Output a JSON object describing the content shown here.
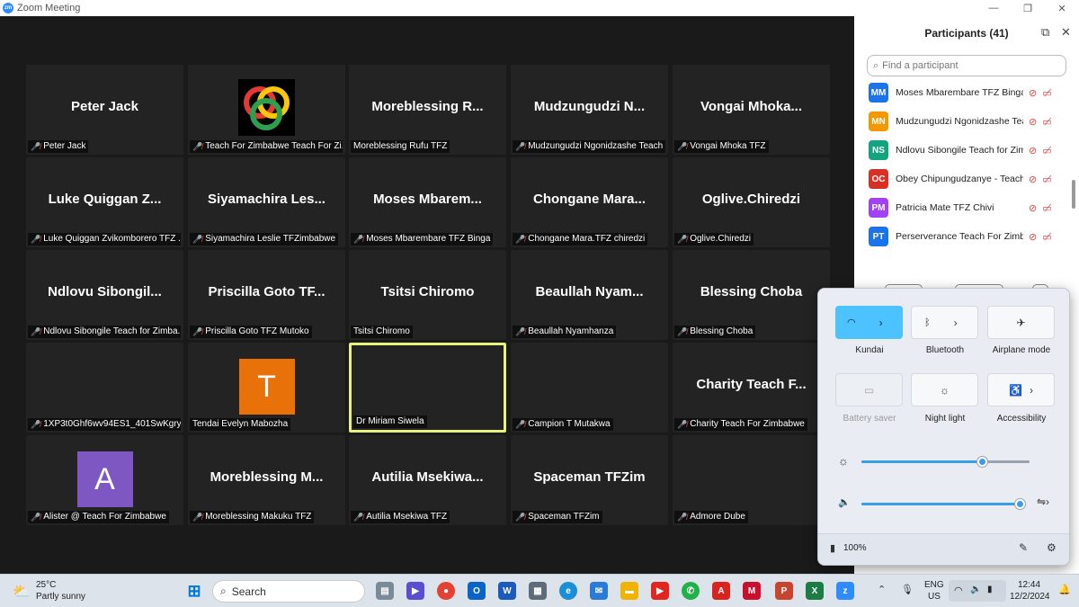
{
  "window": {
    "title": "Zoom Meeting",
    "app_icon": "zm"
  },
  "tiles": [
    {
      "big": "Peter Jack",
      "name": "Peter Jack",
      "muted": true
    },
    {
      "big": "",
      "name": "Teach For Zimbabwe Teach For Zi...",
      "muted": true,
      "logo": true
    },
    {
      "big": "Moreblessing  R...",
      "name": "Moreblessing Rufu TFZ",
      "muted": false
    },
    {
      "big": "Mudzungudzi  N...",
      "name": "Mudzungudzi Ngonidzashe Teach ...",
      "muted": true
    },
    {
      "big": "Vongai  Mhoka...",
      "name": "Vongai Mhoka TFZ",
      "muted": true
    },
    {
      "big": "Luke Quiggan Z...",
      "name": "Luke Quiggan Zvikomborero TFZ ...",
      "muted": true
    },
    {
      "big": "Siyamachira  Les...",
      "name": "Siyamachira Leslie TFZimbabwe",
      "muted": true
    },
    {
      "big": "Moses  Mbarem...",
      "name": "Moses Mbarembare TFZ Binga",
      "muted": true
    },
    {
      "big": "Chongane  Mara...",
      "name": "Chongane Mara.TFZ chiredzi",
      "muted": true
    },
    {
      "big": "Oglive.Chiredzi",
      "name": "Oglive.Chiredzi",
      "muted": true
    },
    {
      "big": "Ndlovu  Sibongil...",
      "name": "Ndlovu Sibongile Teach for Zimba...",
      "muted": true
    },
    {
      "big": "Priscilla  Goto  TF...",
      "name": "Priscilla Goto TFZ Mutoko",
      "muted": true
    },
    {
      "big": "Tsitsi Chiromo",
      "name": "Tsitsi Chiromo",
      "muted": false
    },
    {
      "big": "Beaullah  Nyam...",
      "name": "Beaullah Nyamhanza",
      "muted": true
    },
    {
      "big": "Blessing Choba",
      "name": "Blessing Choba",
      "muted": true
    },
    {
      "big": "",
      "name": "1XP3t0Ghf6wv94ES1_401SwKgry...",
      "muted": true,
      "photo": "blur"
    },
    {
      "big": "",
      "name": "Tendai Evelyn Mabozha",
      "muted": false,
      "avatar": "T",
      "avatar_color": "#e8710a"
    },
    {
      "big": "",
      "name": "Dr Miriam Siwela",
      "muted": false,
      "photo": "video",
      "active": true
    },
    {
      "big": "",
      "name": "Campion T Mutakwa",
      "muted": true,
      "photo": "bw"
    },
    {
      "big": "Charity  Teach  F...",
      "name": "Charity Teach For Zimbabwe",
      "muted": true
    },
    {
      "big": "",
      "name": "Alister @ Teach For Zimbabwe",
      "muted": true,
      "avatar": "A",
      "avatar_color": "#7e57c2"
    },
    {
      "big": "Moreblessing  M...",
      "name": "Moreblessing Makuku TFZ",
      "muted": true
    },
    {
      "big": "Autilia  Msekiwa...",
      "name": "Autilia Msekiwa TFZ",
      "muted": true
    },
    {
      "big": "Spaceman TFZim",
      "name": "Spaceman TFZim",
      "muted": true
    },
    {
      "big": "",
      "name": "Admore Dube",
      "muted": true,
      "photo": "man"
    }
  ],
  "participants": {
    "title": "Participants (41)",
    "search_placeholder": "Find a participant",
    "rows": [
      {
        "initials": "MM",
        "name": "Moses Mbarembare TFZ Binga",
        "color": "#1a73e8"
      },
      {
        "initials": "MN",
        "name": "Mudzungudzi Ngonidzashe Teac...",
        "color": "#f29900"
      },
      {
        "initials": "NS",
        "name": "Ndlovu Sibongile Teach for Zimb...",
        "color": "#12a37f"
      },
      {
        "initials": "OC",
        "name": "Obey Chipungudzanye - Teach f...",
        "color": "#d93025"
      },
      {
        "initials": "PM",
        "name": "Patricia Mate TFZ Chivi",
        "color": "#a142f4"
      },
      {
        "initials": "PT",
        "name": "Perserverance Teach For Zimbab...",
        "color": "#1a73e8"
      }
    ],
    "invite_label": "Invite",
    "mute_all_label": "Mute All",
    "more_label": "..."
  },
  "quick_settings": {
    "wifi_label": "Kundai",
    "bluetooth_label": "Bluetooth",
    "airplane_label": "Airplane mode",
    "battery_saver_label": "Battery saver",
    "night_light_label": "Night light",
    "accessibility_label": "Accessibility",
    "brightness": 0.72,
    "volume": 0.98,
    "battery": "100%"
  },
  "taskbar": {
    "weather_temp": "25°C",
    "weather_desc": "Partly sunny",
    "search_label": "Search",
    "lang_line1": "ENG",
    "lang_line2": "US",
    "time": "12:44",
    "date": "12/2/2024",
    "accent": "#0078d4"
  }
}
